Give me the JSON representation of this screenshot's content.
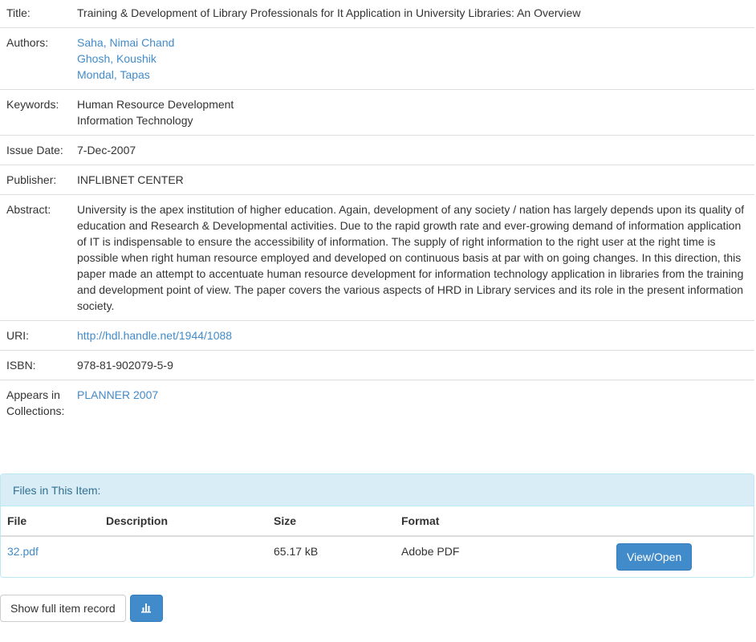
{
  "item_metadata": {
    "title_label": "Title:",
    "title": "Training & Development of Library Professionals for It Application in University Libraries: An Overview",
    "authors_label": "Authors:",
    "authors": [
      "Saha, Nimai Chand",
      "Ghosh, Koushik",
      "Mondal, Tapas"
    ],
    "keywords_label": "Keywords:",
    "keywords": [
      "Human Resource Development",
      "Information Technology"
    ],
    "issue_date_label": "Issue Date:",
    "issue_date": "7-Dec-2007",
    "publisher_label": "Publisher:",
    "publisher": "INFLIBNET CENTER",
    "abstract_label": "Abstract:",
    "abstract": "University is the apex institution of higher education. Again, development of any society / nation has largely depends upon its quality of education and Research & Developmental activities. Due to the rapid growth rate and ever-growing demand of information application of IT is indispensable to ensure the accessibility of information. The supply of right information to the right user at the right time is possible when right human resource employed and developed on continuous basis at par with on going changes. In this direction, this paper made an attempt to accentuate human resource development for information technology application in libraries from the training and development point of view. The paper covers the various aspects of HRD in Library services and its role in the present information society.",
    "uri_label": "URI:",
    "uri": "http://hdl.handle.net/1944/1088",
    "isbn_label": "ISBN:",
    "isbn": "978-81-902079-5-9",
    "collections_label": "Appears in Collections:",
    "collections": "PLANNER 2007"
  },
  "files_panel": {
    "heading": "Files in This Item:",
    "columns": [
      "File",
      "Description",
      "Size",
      "Format",
      ""
    ],
    "rows": [
      {
        "file": "32.pdf",
        "description": "",
        "size": "65.17 kB",
        "format": "Adobe PDF",
        "action": "View/Open"
      }
    ]
  },
  "actions": {
    "show_full_record": "Show full item record",
    "stats_icon": "bar-chart-icon"
  },
  "colors": {
    "link": "#428bca",
    "primary_button": "#428bca",
    "panel_heading_bg": "#d9edf7",
    "panel_heading_text": "#31708f"
  }
}
